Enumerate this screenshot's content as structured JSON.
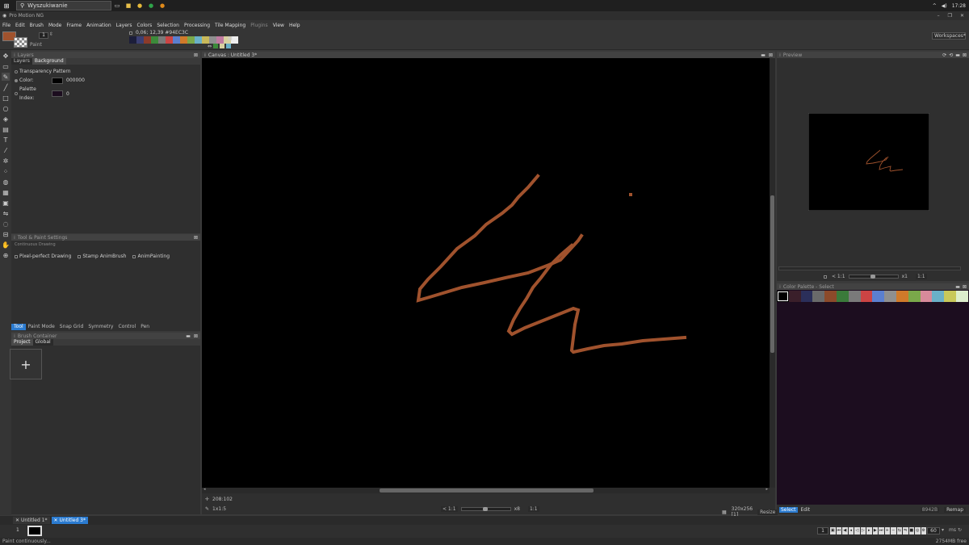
{
  "taskbar": {
    "search_text": "Wyszukiwanie",
    "clock": "17:28"
  },
  "app": {
    "title": "Pro Motion NG"
  },
  "menu": [
    "File",
    "Edit",
    "Brush",
    "Mode",
    "Frame",
    "Animation",
    "Layers",
    "Colors",
    "Selection",
    "Processing",
    "Tile Mapping",
    "Plugins",
    "View",
    "Help"
  ],
  "menu_disabled": [
    "Plugins"
  ],
  "toolbar": {
    "brush_size": "1",
    "paint_label": "Paint",
    "coord_text": "0,06; 12,39 #94EC3C",
    "workspaces": "Workspaces*"
  },
  "palette_swatches": [
    "#1c1e3a",
    "#3b3f73",
    "#8c3b2a",
    "#3c8a3a",
    "#7a7a7a",
    "#cc4444",
    "#5b7fd0",
    "#d07a2a",
    "#7aa84a",
    "#6ab0c8",
    "#c8b85a",
    "#8f8f8f",
    "#c07aa0",
    "#d8d0a0",
    "#eeeeee"
  ],
  "layers": {
    "panel_title": "Layers",
    "tabs": [
      "Layers",
      "Background"
    ],
    "transparency_pattern": "Transparency Pattern",
    "color_label": "Color:",
    "color_value": "000000",
    "palette_index_label": "Palette Index:",
    "palette_index_value": "0"
  },
  "tool_settings": {
    "panel_title": "Tool & Paint Settings",
    "subtitle": "Continuous Drawing",
    "options": [
      "Pixel-perfect Drawing",
      "Stamp AnimBrush",
      "AnimPainting"
    ],
    "tabs": [
      "Tool",
      "Paint Mode",
      "Snap Grid",
      "Symmetry",
      "Control",
      "Pen"
    ]
  },
  "brush_container": {
    "panel_title": "Brush Container",
    "tabs": [
      "Project",
      "Global"
    ],
    "add": "+"
  },
  "canvas": {
    "title": "Canvas : Untitled 3*",
    "coords": "208:102",
    "brush_dims": "1x1:5",
    "zoom": "< 1:1",
    "zoom_x": "x8",
    "ratio": "1:1",
    "size": "320x256 [1]",
    "resize": "Resize"
  },
  "preview": {
    "title": "Preview",
    "zoom": "< 1:1",
    "zoom_x": "x1",
    "ratio": "1:1"
  },
  "color_palette": {
    "title": "Color Palette - Select",
    "swatches": [
      "#000000",
      "#3a1f2a",
      "#2b2f5a",
      "#6a6a6a",
      "#8c4a2a",
      "#3a7a3a",
      "#7a7a7a",
      "#cc4444",
      "#5b7fd0",
      "#8f8f8f",
      "#d07a2a",
      "#7aa84a",
      "#d88a9a",
      "#6ab0c8",
      "#c8c85a",
      "#ddeecc"
    ],
    "tabs": [
      "Select",
      "Edit"
    ],
    "count": "8942B",
    "remap": "Remap"
  },
  "docs": [
    "Untitled 1*",
    "Untitled 3*"
  ],
  "frame": {
    "number": "1"
  },
  "status": {
    "text": "Paint continuously...",
    "memory": "2754MB free",
    "fps": "60"
  },
  "colors": {
    "brush": "#a0522d",
    "panel": "#2f2f2f",
    "canvas": "#000000",
    "palette_bg": "#1c0d1f",
    "accent": "#2b7bd0"
  }
}
